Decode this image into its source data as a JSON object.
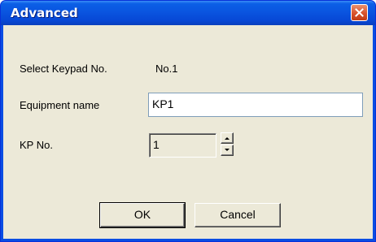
{
  "window": {
    "title": "Advanced",
    "close_icon": "close-icon"
  },
  "form": {
    "keypad_label": "Select Keypad No.",
    "keypad_value": "No.1",
    "equipment_label": "Equipment name",
    "equipment_value": "KP1",
    "kpno_label": "KP No.",
    "kpno_value": "1"
  },
  "buttons": {
    "ok": "OK",
    "cancel": "Cancel"
  },
  "colors": {
    "titlebar": "#0a55e0",
    "dialog_bg": "#ece9d8",
    "close_button": "#d8522c"
  }
}
